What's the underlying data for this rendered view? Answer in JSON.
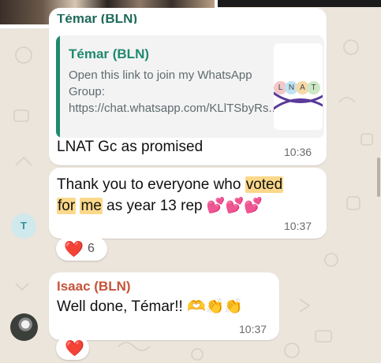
{
  "colors": {
    "background": "#ece5dc",
    "bubble": "#ffffff",
    "quote_accent": "#1f8a70",
    "highlight": "#fbd88a",
    "sender_isaac": "#c6533a",
    "reaction_heart": "#e0243b"
  },
  "messages": [
    {
      "clipped_sender": "Témar (BLN)",
      "quote": {
        "sender": "Témar (BLN)",
        "text": "Open this link to join my WhatsApp Group: https://chat.whatsapp.com/KLlTSbyRs...",
        "thumbnail_letters": [
          "L",
          "N",
          "A",
          "T"
        ]
      },
      "text": "LNAT Gc as promised",
      "time": "10:36"
    },
    {
      "text_before": "Thank you to everyone who ",
      "highlight1": "voted",
      "text_space": " ",
      "highlight2a": "for",
      "text_space2": " ",
      "highlight2b": "me",
      "text_after": " as year 13 rep ",
      "emoji": "💕💕💕",
      "time": "10:37",
      "avatar_initial": "T",
      "reaction": {
        "emoji": "❤️",
        "count": "6"
      }
    },
    {
      "sender": "Isaac (BLN)",
      "text": "Well done, Témar!! ",
      "emoji": "🫶👏👏",
      "time": "10:37",
      "reaction": {
        "emoji": "❤️"
      }
    }
  ]
}
